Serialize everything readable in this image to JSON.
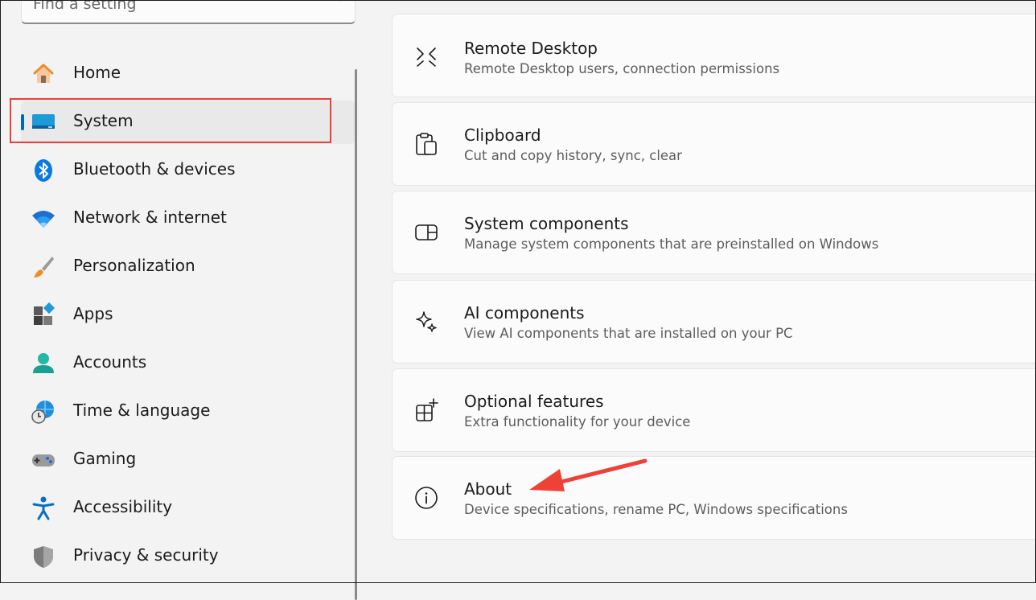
{
  "search": {
    "placeholder": "Find a setting",
    "icon": "search-icon"
  },
  "sidebar": {
    "selected": "System",
    "items": [
      {
        "label": "Home",
        "icon": "home-icon"
      },
      {
        "label": "System",
        "icon": "system-display-icon"
      },
      {
        "label": "Bluetooth & devices",
        "icon": "bluetooth-icon"
      },
      {
        "label": "Network & internet",
        "icon": "wifi-icon"
      },
      {
        "label": "Personalization",
        "icon": "brush-icon"
      },
      {
        "label": "Apps",
        "icon": "apps-icon"
      },
      {
        "label": "Accounts",
        "icon": "account-icon"
      },
      {
        "label": "Time & language",
        "icon": "globe-clock-icon"
      },
      {
        "label": "Gaming",
        "icon": "gamepad-icon"
      },
      {
        "label": "Accessibility",
        "icon": "accessibility-icon"
      },
      {
        "label": "Privacy & security",
        "icon": "shield-icon"
      }
    ]
  },
  "main": {
    "cards": [
      {
        "title": "Remote Desktop",
        "desc": "Remote Desktop users, connection permissions",
        "icon": "remote-desktop-icon"
      },
      {
        "title": "Clipboard",
        "desc": "Cut and copy history, sync, clear",
        "icon": "clipboard-icon"
      },
      {
        "title": "System components",
        "desc": "Manage system components that are preinstalled on Windows",
        "icon": "system-components-icon"
      },
      {
        "title": "AI components",
        "desc": "View AI components that are installed on your PC",
        "icon": "sparkle-icon"
      },
      {
        "title": "Optional features",
        "desc": "Extra functionality for your device",
        "icon": "optional-features-icon"
      },
      {
        "title": "About",
        "desc": "Device specifications, rename PC, Windows specifications",
        "icon": "info-icon"
      }
    ]
  },
  "colors": {
    "accent": "#0067c0",
    "highlight": "#e8403a",
    "annotation_arrow": "#ef4136"
  }
}
